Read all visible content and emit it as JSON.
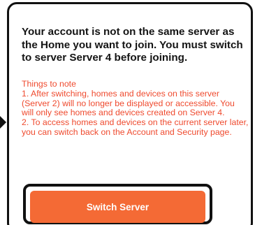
{
  "dialog": {
    "headline": "Your account is not on the same server as the Home you want to join. You must switch to server Server 4 before joining.",
    "notes_title": "Things to note",
    "notes": [
      "1. After switching, homes and devices on this server (Server 2) will no longer be displayed or accessible. You will only see homes and devices created on Server 4.",
      "2. To access homes and devices on the current server later, you can switch back on the Account and Security page."
    ],
    "switch_button_label": "Switch Server"
  },
  "colors": {
    "notes_text": "#ef4a2e",
    "button_background": "#f46a35",
    "button_text": "#ffffff",
    "headline_text": "#141414",
    "outline": "#111111"
  }
}
